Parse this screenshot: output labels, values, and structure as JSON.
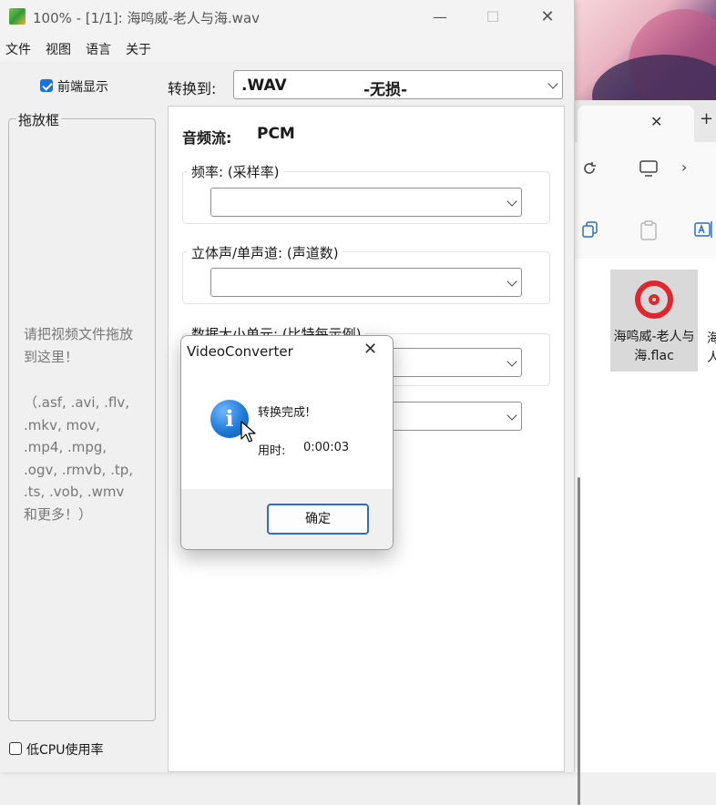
{
  "window": {
    "title": "100% - [1/1]: 海鸣威-老人与海.wav",
    "minimize": "—",
    "maximize": "☐",
    "close": "✕"
  },
  "menu": [
    "文件",
    "视图",
    "语言",
    "关于"
  ],
  "left": {
    "always_on_top": {
      "label": "前端显示",
      "checked": true
    },
    "dropzone_title": "拖放框",
    "drop_hint": "请把视频文件拖放到这里！",
    "drop_formats": "（.asf, .avi, .flv, .mkv, mov, .mp4, .mpg, .ogv, .rmvb, .tp, .ts, .vob, .wmv 和更多！）",
    "low_cpu": {
      "label": "低CPU使用率",
      "checked": false
    }
  },
  "convert": {
    "label": "转换到:",
    "format_ext": ".WAV",
    "format_desc": "-无损-"
  },
  "audio": {
    "stream_label": "音频流:",
    "stream_value": "PCM",
    "groups": [
      {
        "title": "频率:   (采样率)"
      },
      {
        "title": "立体声/单声道:   (声道数)"
      },
      {
        "title": "数据大小单元:   (比特每示例)"
      }
    ]
  },
  "dialog": {
    "title": "VideoConverter",
    "close": "✕",
    "message": "转换完成!",
    "time_label": "用时:",
    "time_value": "0:00:03",
    "ok": "确定"
  },
  "explorer": {
    "tab_close": "✕",
    "new_tab": "+",
    "file_name": "海鸣威-老人与海.flac",
    "next_file_partial": "海 人"
  }
}
